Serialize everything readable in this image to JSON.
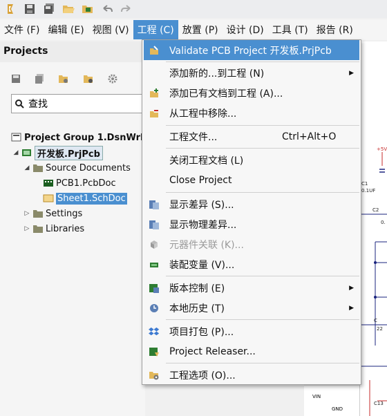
{
  "menubar": {
    "file": "文件 (F)",
    "edit": "编辑 (E)",
    "view": "视图 (V)",
    "project": "工程 (C)",
    "place": "放置 (P)",
    "design": "设计 (D)",
    "tools": "工具 (T)",
    "reports": "报告 (R)"
  },
  "panel": {
    "title": "Projects",
    "search_placeholder": "查找"
  },
  "tree": {
    "group": "Project Group 1.DsnWrk",
    "project": "开发板.PrjPcb",
    "source_docs": "Source Documents",
    "pcb": "PCB1.PcbDoc",
    "sch": "Sheet1.SchDoc",
    "settings": "Settings",
    "libraries": "Libraries"
  },
  "dropdown": {
    "validate": "Validate PCB Project 开发板.PrjPcb",
    "add_new": "添加新的...到工程 (N)",
    "add_existing": "添加已有文档到工程 (A)...",
    "remove": "从工程中移除...",
    "project_files": "工程文件...",
    "project_files_shortcut": "Ctrl+Alt+O",
    "close_docs": "关闭工程文档 (L)",
    "close_project": "Close Project",
    "show_diff": "显示差异 (S)...",
    "show_phys_diff": "显示物理差异...",
    "component_links": "元器件关联 (K)...",
    "variants": "装配变量 (V)...",
    "version_control": "版本控制 (E)",
    "local_history": "本地历史 (T)",
    "pack": "项目打包 (P)...",
    "releaser": "Project Releaser...",
    "options": "工程选项 (O)..."
  },
  "schematic": {
    "c1": "C1",
    "c1_val": "0.1UF",
    "v5": "+5V",
    "c2": "C2",
    "c2_val": "0.",
    "c_low": "C",
    "c_low_val": "22",
    "vin": "VIN",
    "gnd": "GND",
    "c13": "C13"
  },
  "colors": {
    "accent": "#4a8fd0",
    "schematic_wire": "#1a237e",
    "schematic_red": "#c62828"
  }
}
